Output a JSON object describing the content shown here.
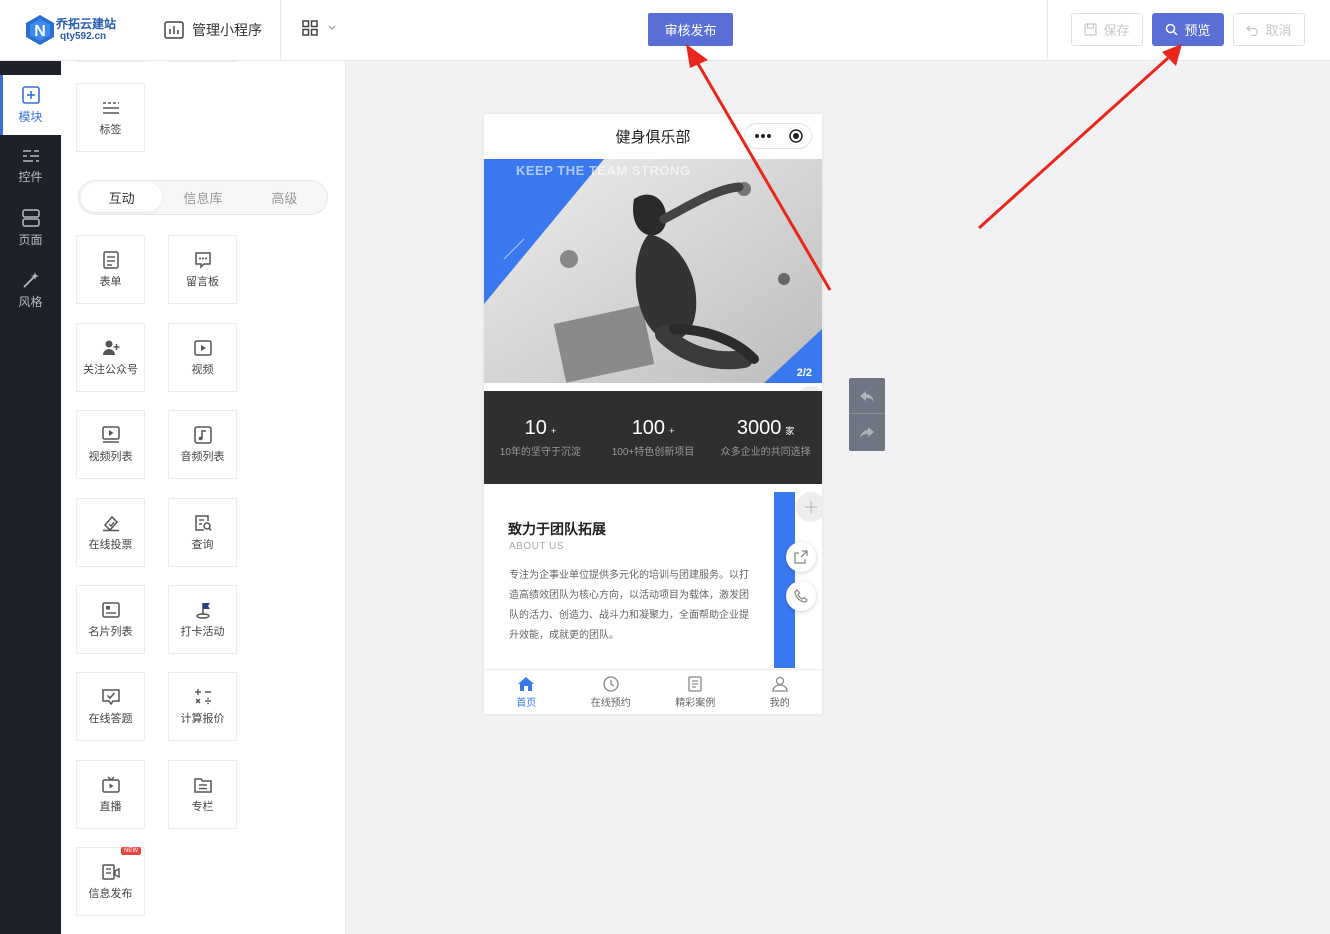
{
  "header": {
    "logo_title": "乔拓云建站",
    "logo_domain": "qty592.cn",
    "manage_label": "管理小程序",
    "publish_label": "审核发布",
    "save_label": "保存",
    "preview_label": "预览",
    "cancel_label": "取消"
  },
  "sidebar": {
    "items": [
      {
        "label": "模块",
        "icon": "plus-square-icon",
        "active": true
      },
      {
        "label": "控件",
        "icon": "sliders-icon"
      },
      {
        "label": "页面",
        "icon": "pages-icon"
      },
      {
        "label": "风格",
        "icon": "magic-wand-icon"
      }
    ]
  },
  "panel": {
    "top_tile": "标签",
    "tabs": [
      "互动",
      "信息库",
      "高级"
    ],
    "active_tab": "互动",
    "tiles": [
      "表单",
      "留言板",
      "关注公众号",
      "视频",
      "视频列表",
      "音频列表",
      "在线投票",
      "查询",
      "名片列表",
      "打卡活动",
      "在线答题",
      "计算报价",
      "直播",
      "专栏",
      "信息发布"
    ],
    "new_badge": "NEW"
  },
  "phone": {
    "title": "健身俱乐部",
    "banner_text": "KEEP THE TEAM STRONG",
    "banner_page": "2/2",
    "stats": [
      {
        "num": "10",
        "unit": "+",
        "desc": "10年的坚守于沉淀"
      },
      {
        "num": "100",
        "unit": "+",
        "desc": "100+特色创新项目"
      },
      {
        "num": "3000",
        "unit": "家",
        "desc": "众多企业的共同选择"
      }
    ],
    "about": {
      "title": "致力于团队拓展",
      "subtitle": "ABOUT US",
      "body": "专注为企事业单位提供多元化的培训与团建服务。以打造高绩效团队为核心方向，以活动项目为载体，激发团队的活力、创造力、战斗力和凝聚力，全面帮助企业提升效能，成就更的团队。"
    },
    "tabbar": [
      "首页",
      "在线预约",
      "精彩案例",
      "我的"
    ]
  },
  "colors": {
    "accent": "#5a6fd6",
    "brand_blue": "#3a78f0",
    "sidebar_bg": "#1f2129",
    "arrow_red": "#e8261c"
  }
}
